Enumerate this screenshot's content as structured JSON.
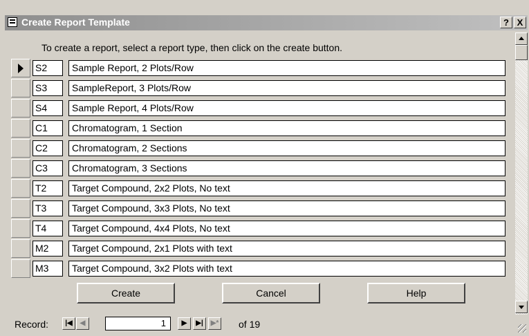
{
  "window": {
    "title": "Create Report Template",
    "help_label": "?",
    "close_label": "X"
  },
  "instructions": "To create  a report, select a report type, then click on the create button.",
  "rows": [
    {
      "code": "S2",
      "description": "Sample Report, 2 Plots/Row",
      "current": true
    },
    {
      "code": "S3",
      "description": "SampleReport, 3 Plots/Row"
    },
    {
      "code": "S4",
      "description": "Sample Report, 4 Plots/Row"
    },
    {
      "code": "C1",
      "description": "Chromatogram, 1 Section"
    },
    {
      "code": "C2",
      "description": "Chromatogram, 2 Sections"
    },
    {
      "code": "C3",
      "description": "Chromatogram, 3 Sections"
    },
    {
      "code": "T2",
      "description": "Target Compound, 2x2 Plots, No text"
    },
    {
      "code": "T3",
      "description": "Target Compound, 3x3 Plots, No text"
    },
    {
      "code": "T4",
      "description": "Target Compound, 4x4 Plots, No text"
    },
    {
      "code": "M2",
      "description": "Target Compound, 2x1 Plots with text"
    },
    {
      "code": "M3",
      "description": "Target Compound, 3x2 Plots with text"
    }
  ],
  "buttons": {
    "create": "Create",
    "cancel": "Cancel",
    "help": "Help"
  },
  "navigator": {
    "record_label": "Record:",
    "current_record": "1",
    "of_label": "of 19",
    "icons": [
      "first-record-icon",
      "previous-record-icon",
      "next-record-icon",
      "last-record-icon",
      "new-record-icon"
    ]
  }
}
